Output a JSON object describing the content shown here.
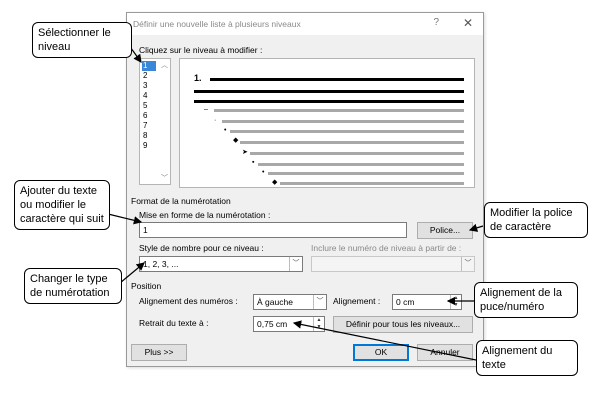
{
  "dialog": {
    "title": "Définir une nouvelle liste à plusieurs niveaux",
    "help_glyph": "?",
    "close_glyph": "✕",
    "level_label": "Cliquez sur le niveau à modifier :",
    "levels": [
      "1",
      "2",
      "3",
      "4",
      "5",
      "6",
      "7",
      "8",
      "9"
    ],
    "selected_level": "1",
    "preview_number": "1.",
    "section_format": "Format de la numérotation",
    "format_label": "Mise en forme de la numérotation :",
    "format_value": "1",
    "font_button": "Police...",
    "style_label": "Style de nombre pour ce niveau :",
    "style_value": "1, 2, 3, ...",
    "include_label": "Inclure le numéro de niveau à partir de :",
    "include_value": "",
    "section_position": "Position",
    "number_align_label": "Alignement des numéros :",
    "number_align_value": "À gauche",
    "align_label": "Alignement :",
    "align_value": "0 cm",
    "indent_label": "Retrait du texte à :",
    "indent_value": "0,75 cm",
    "set_all_button": "Définir pour tous les niveaux...",
    "more_button": "Plus >>",
    "ok_button": "OK",
    "cancel_button": "Annuler"
  },
  "callouts": {
    "select_level": "Sélectionner le niveau",
    "add_text": "Ajouter du texte ou modifier le caractère qui suit",
    "modify_font": "Modifier la police de caractère",
    "change_type": "Changer le type de numérotation",
    "align_bullet": "Alignement de la puce/numéro",
    "align_text": "Alignement du texte"
  }
}
